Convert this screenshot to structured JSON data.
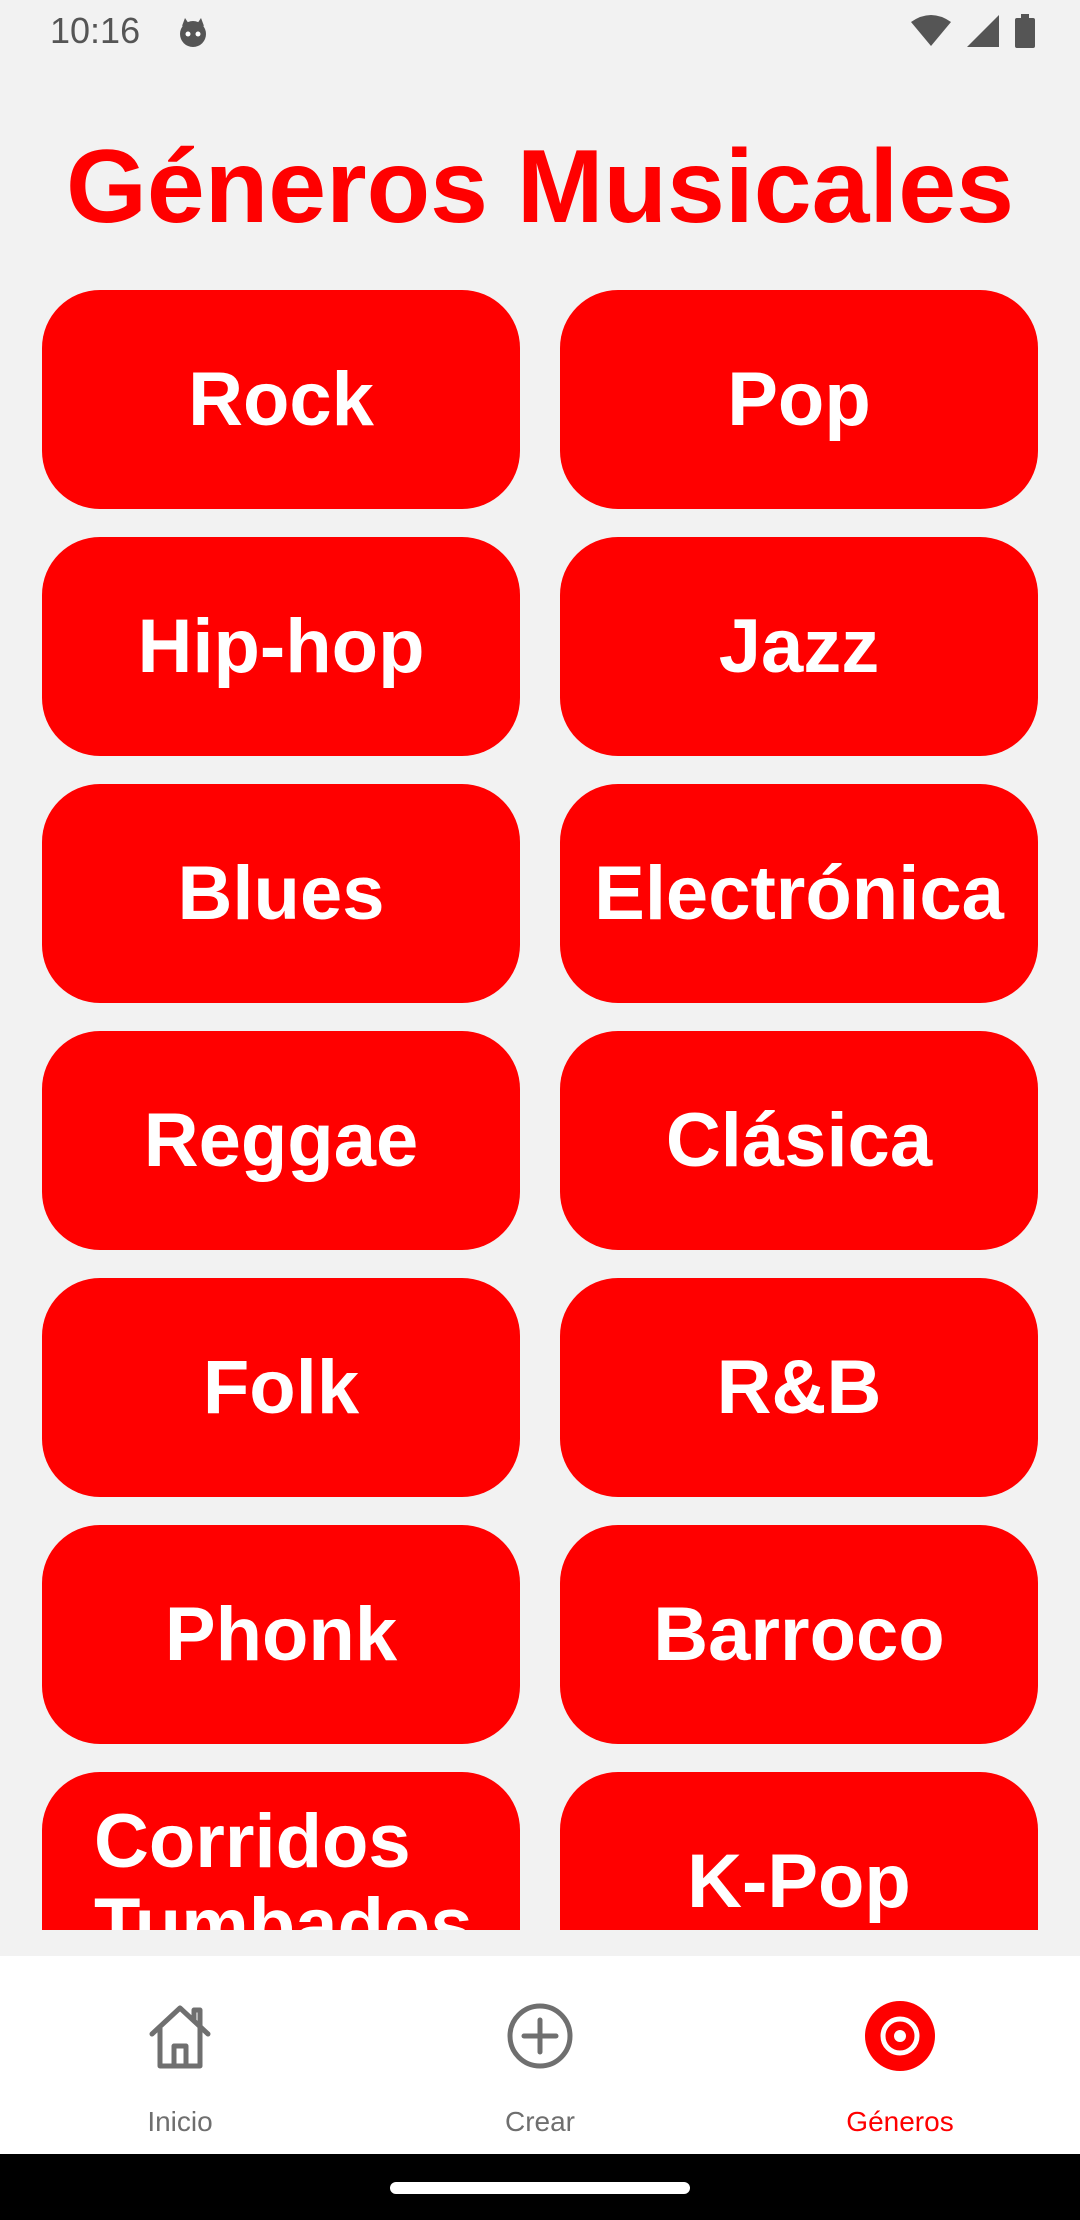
{
  "status_bar": {
    "time": "10:16"
  },
  "title": "Géneros Musicales",
  "genres": [
    "Rock",
    "Pop",
    "Hip-hop",
    "Jazz",
    "Blues",
    "Electrónica",
    "Reggae",
    "Clásica",
    "Folk",
    "R&B",
    "Phonk",
    "Barroco",
    "Corridos Tumbados",
    "K-Pop"
  ],
  "bottom_nav": {
    "items": [
      {
        "label": "Inicio",
        "icon": "home-icon",
        "active": false
      },
      {
        "label": "Crear",
        "icon": "add-circle-icon",
        "active": false
      },
      {
        "label": "Géneros",
        "icon": "target-icon",
        "active": true
      }
    ]
  },
  "colors": {
    "accent": "#ff0000",
    "background": "#f2f2f2",
    "nav_background": "#ffffff",
    "nav_inactive": "#6f6f6f"
  }
}
